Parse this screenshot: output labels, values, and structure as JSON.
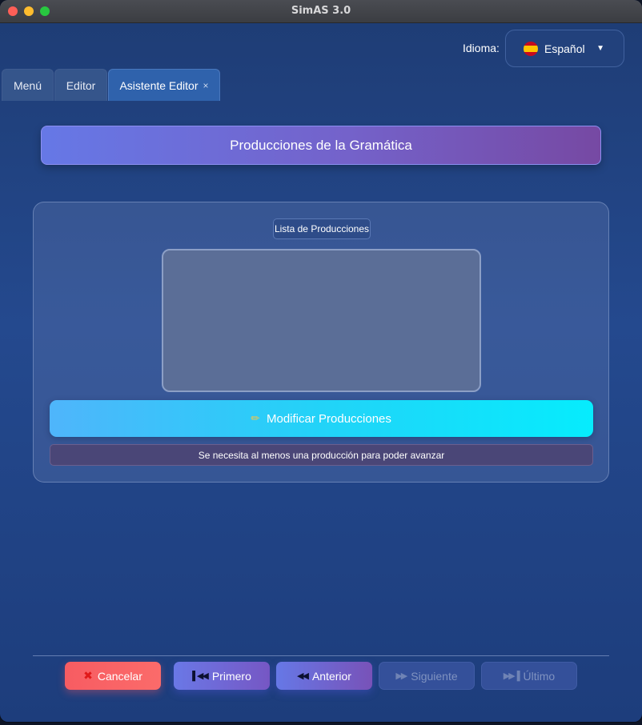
{
  "window": {
    "title": "SimAS 3.0"
  },
  "language": {
    "label": "Idioma:",
    "value": "Español",
    "flag_icon": "spain-flag-icon"
  },
  "tabs": [
    {
      "label": "Menú"
    },
    {
      "label": "Editor"
    },
    {
      "label": "Asistente Editor",
      "close": "×"
    }
  ],
  "banner": {
    "title": "Producciones de la Gramática"
  },
  "productions": {
    "list_title": "Lista de Producciones",
    "items": [],
    "modify_label": "Modificar Producciones",
    "warning": "Se necesita al menos una producción para poder avanzar"
  },
  "nav": {
    "cancel": "Cancelar",
    "first": "Primero",
    "previous": "Anterior",
    "next": "Siguiente",
    "last": "Último"
  },
  "colors": {
    "accent_cyan": "#06ecfd",
    "cancel_red": "#f75c62",
    "nav_purple": "#7657c4"
  }
}
